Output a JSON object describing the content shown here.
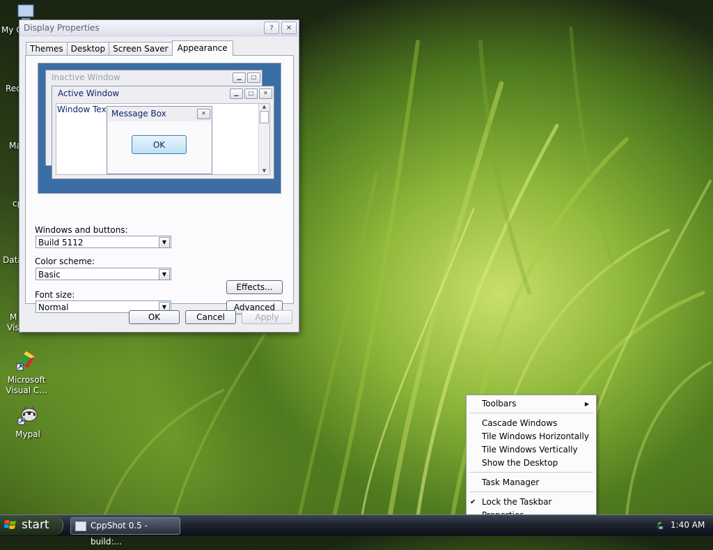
{
  "desktop": {
    "icons": [
      {
        "label": "My C"
      },
      {
        "label": "Rec"
      },
      {
        "label": "Ma"
      },
      {
        "label": "cp"
      },
      {
        "label": "Data"
      },
      {
        "label": "M"
      },
      {
        "label": "Visu"
      },
      {
        "label": "Microsoft"
      },
      {
        "label": "Visual C..."
      },
      {
        "label": "Mypal"
      }
    ]
  },
  "dialog": {
    "title": "Display Properties",
    "help_btn": "?",
    "close_btn": "✕",
    "tabs": [
      {
        "label": "Themes"
      },
      {
        "label": "Desktop"
      },
      {
        "label": "Screen Saver"
      },
      {
        "label": "Appearance"
      }
    ],
    "preview": {
      "inactive_title": "Inactive Window",
      "active_title": "Active Window",
      "window_text": "Window Text",
      "message_box_title": "Message Box",
      "ok_label": "OK"
    },
    "fields": {
      "windows_buttons_label": "Windows and buttons:",
      "windows_buttons_value": "Build 5112",
      "color_scheme_label": "Color scheme:",
      "color_scheme_value": "Basic",
      "font_size_label": "Font size:",
      "font_size_value": "Normal"
    },
    "effects_label": "Effects...",
    "advanced_label": "Advanced",
    "ok_label": "OK",
    "cancel_label": "Cancel",
    "apply_label": "Apply"
  },
  "context_menu": {
    "items": [
      {
        "label": "Toolbars"
      },
      {
        "label": "Cascade Windows"
      },
      {
        "label": "Tile Windows Horizontally"
      },
      {
        "label": "Tile Windows Vertically"
      },
      {
        "label": "Show the Desktop"
      },
      {
        "label": "Task Manager"
      },
      {
        "label": "Lock the Taskbar"
      },
      {
        "label": "Properties"
      }
    ],
    "submenu_arrow": "▶",
    "check_mark": "✔"
  },
  "taskbar": {
    "start_label": "start",
    "task_label": "CppShot 0.5 - build:...",
    "clock": "1:40 AM"
  },
  "colors": {
    "preview_background": "#3a6ea5",
    "active_title_text": "#0a246a"
  }
}
